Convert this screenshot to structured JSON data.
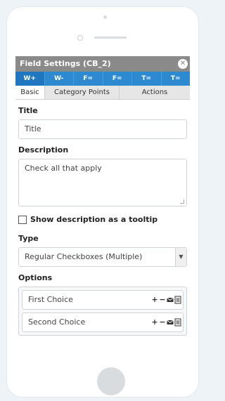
{
  "panel": {
    "title": "Field Settings (CB_2)",
    "close_icon": "close-circle-icon"
  },
  "toolbar": {
    "buttons": [
      {
        "label": "W+",
        "active": true
      },
      {
        "label": "W-"
      },
      {
        "label": "F="
      },
      {
        "label": "F="
      },
      {
        "label": "T="
      },
      {
        "label": "T="
      }
    ]
  },
  "tabs": [
    "Basic",
    "Category Points",
    "Actions"
  ],
  "form": {
    "title_label": "Title",
    "title_value": "Title",
    "description_label": "Description",
    "description_value": "Check all that apply",
    "tooltip_label": "Show description as a tooltip",
    "type_label": "Type",
    "type_value": "Regular Checkboxes (Multiple)",
    "options_label": "Options",
    "options": [
      {
        "value": "First Choice"
      },
      {
        "value": "Second Choice"
      }
    ]
  },
  "colors": {
    "titlebar": "#8a8a8a",
    "toolbar": "#2d8ad0",
    "background": "#eef3f8"
  }
}
